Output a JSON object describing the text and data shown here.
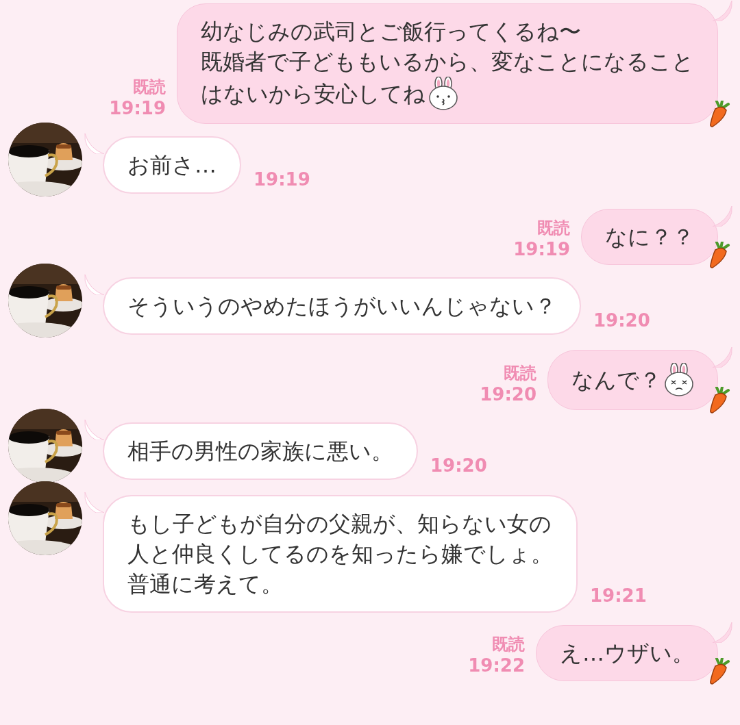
{
  "messages": [
    {
      "kind": "sent",
      "lines": [
        "幼なじみの武司とご飯行ってくるね〜",
        "既婚者で子どももいるから、変なことになること",
        "はないから安心してね"
      ],
      "emoji": {
        "kind": "kiss"
      },
      "read": "既読",
      "time": "19:19"
    },
    {
      "kind": "received",
      "lines": [
        "お前さ…"
      ],
      "time": "19:19"
    },
    {
      "kind": "sent",
      "lines": [
        "なに？？"
      ],
      "read": "既読",
      "time": "19:19"
    },
    {
      "kind": "received",
      "lines": [
        "そういうのやめたほうがいいんじゃない？"
      ],
      "time": "19:20"
    },
    {
      "kind": "sent",
      "lines": [
        "なんで？"
      ],
      "emoji": {
        "kind": "wince"
      },
      "read": "既読",
      "time": "19:20"
    },
    {
      "kind": "received",
      "lines": [
        "相手の男性の家族に悪い。"
      ],
      "time": "19:20"
    },
    {
      "kind": "received",
      "lines": [
        "もし子どもが自分の父親が、知らない女の",
        "人と仲良くしてるのを知ったら嫌でしょ。",
        "普通に考えて。"
      ],
      "time": "19:21"
    },
    {
      "kind": "sent",
      "lines": [
        "え…ウザい。"
      ],
      "read": "既読",
      "time": "19:22"
    }
  ]
}
